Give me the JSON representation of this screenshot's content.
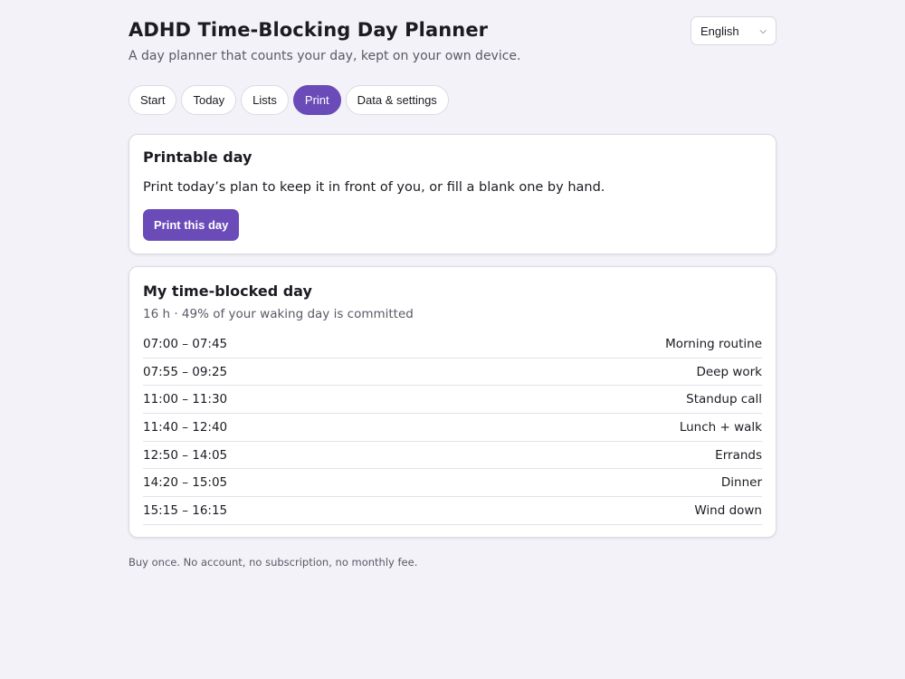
{
  "header": {
    "title": "ADHD Time-Blocking Day Planner",
    "subtitle": "A day planner that counts your day, kept on your own device.",
    "language": "English"
  },
  "tabs": [
    {
      "label": "Start"
    },
    {
      "label": "Today"
    },
    {
      "label": "Lists"
    },
    {
      "label": "Print",
      "active": true
    },
    {
      "label": "Data & settings"
    }
  ],
  "printable": {
    "title": "Printable day",
    "text": "Print today’s plan to keep it in front of you, or fill a blank one by hand.",
    "button_label": "Print this day"
  },
  "day": {
    "title": "My time-blocked day",
    "summary": "16 h · 49% of your waking day is committed",
    "blocks": [
      {
        "time": "07:00 – 07:45",
        "label": "Morning routine"
      },
      {
        "time": "07:55 – 09:25",
        "label": "Deep work"
      },
      {
        "time": "11:00 – 11:30",
        "label": "Standup call"
      },
      {
        "time": "11:40 – 12:40",
        "label": "Lunch + walk"
      },
      {
        "time": "12:50 – 14:05",
        "label": "Errands"
      },
      {
        "time": "14:20 – 15:05",
        "label": "Dinner"
      },
      {
        "time": "15:15 – 16:15",
        "label": "Wind down"
      }
    ]
  },
  "footer": "Buy once. No account, no subscription, no monthly fee.",
  "colors": {
    "accent": "#6a4bb8",
    "background": "#f3f2f8"
  }
}
